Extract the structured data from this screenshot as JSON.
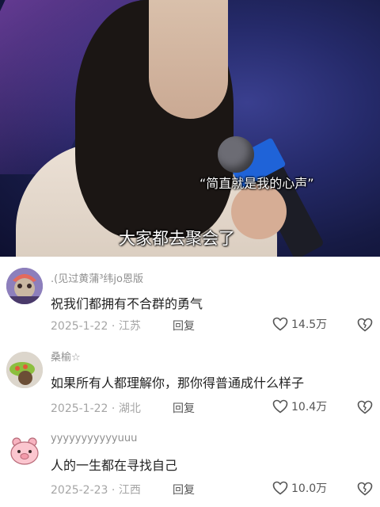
{
  "video": {
    "subtitle_quote": "“简直就是我的心声”",
    "subtitle_main": "大家都去聚会了"
  },
  "comments": [
    {
      "username": ".(见过黄蒲³纬jo恩版",
      "text": "祝我们都拥有不合群的勇气",
      "date": "2025-1-22",
      "location": "江苏",
      "reply": "回复",
      "likes": "14.5万"
    },
    {
      "username": "桑榆☆",
      "text": "如果所有人都理解你，那你得普通成什么样子",
      "date": "2025-1-22",
      "location": "湖北",
      "reply": "回复",
      "likes": "10.4万"
    },
    {
      "username": "yyyyyyyyyyyuuu",
      "text": "人的一生都在寻找自己",
      "date": "2025-2-23",
      "location": "江西",
      "reply": "回复",
      "likes": "10.0万"
    }
  ]
}
